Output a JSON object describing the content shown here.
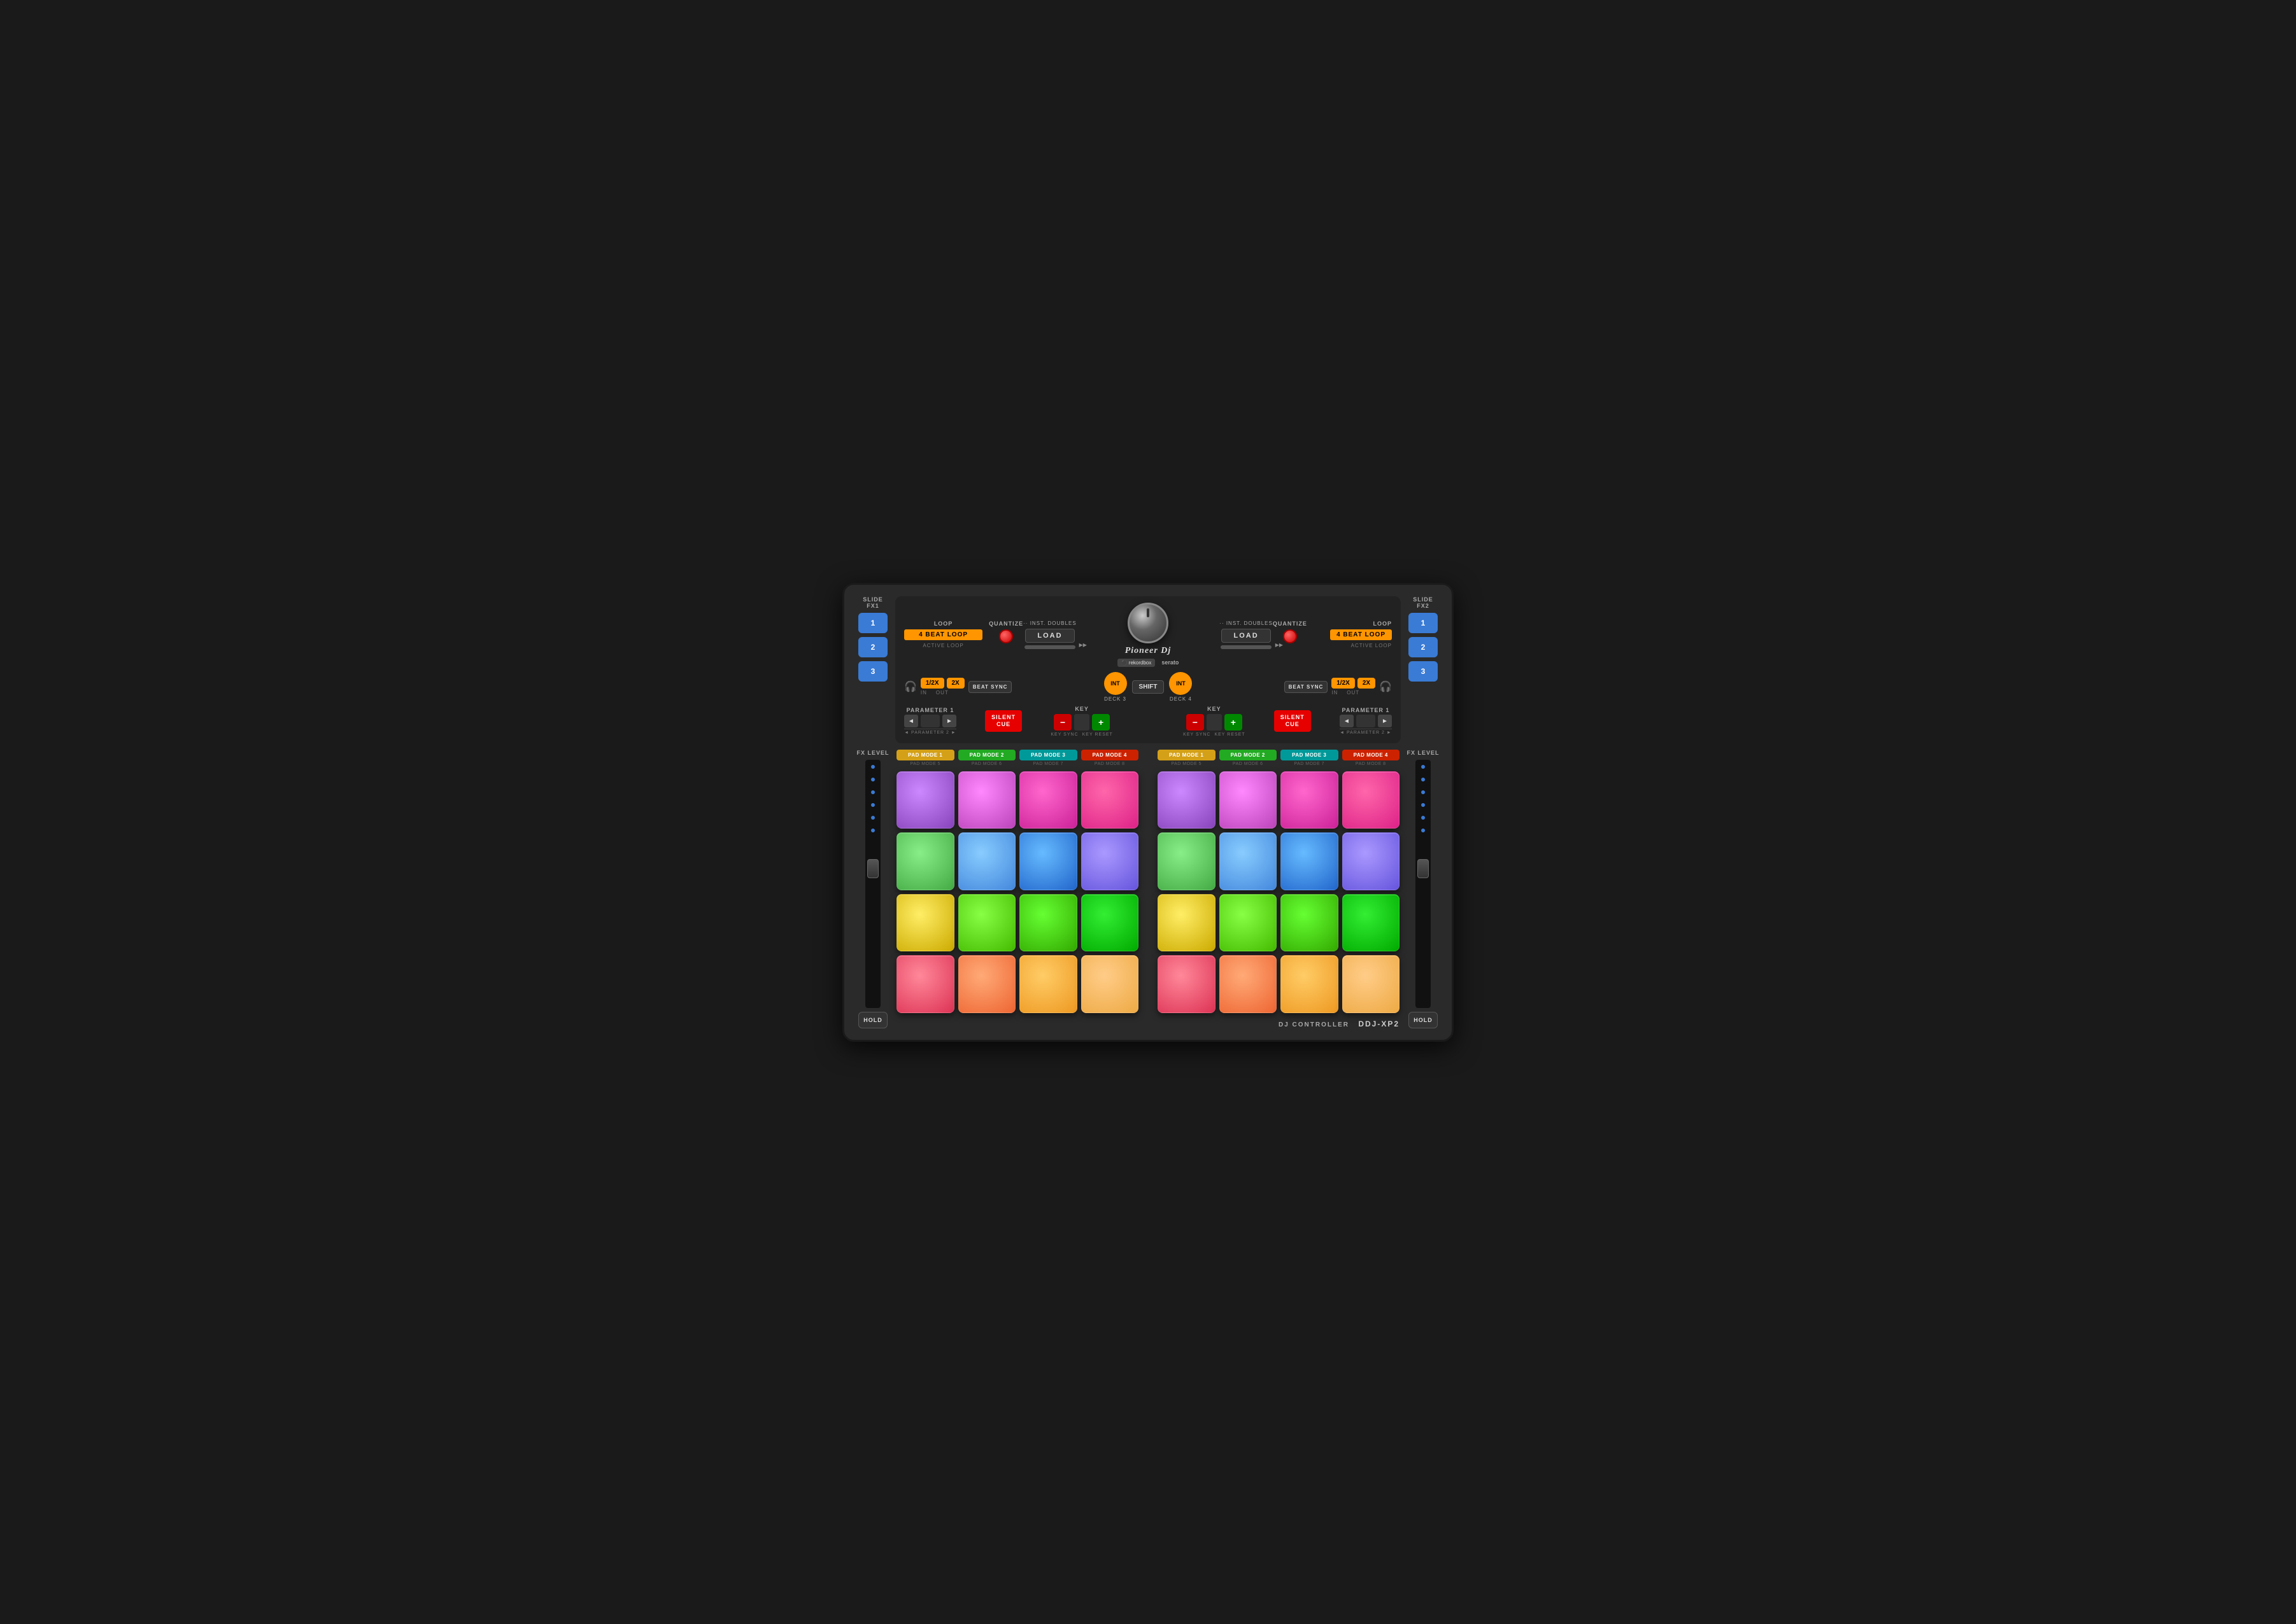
{
  "controller": {
    "model": "DDJ-XP2",
    "brand": "Pioneer Dj",
    "subtitle": "DJ CONTROLLER"
  },
  "slide_fx_left": {
    "label": "SLIDE FX1",
    "buttons": [
      "1",
      "2",
      "3"
    ]
  },
  "slide_fx_right": {
    "label": "SLIDE FX2",
    "buttons": [
      "1",
      "2",
      "3"
    ]
  },
  "deck_left": {
    "loop_label": "LOOP",
    "loop_value": "4 BEAT LOOP",
    "active_loop": "ACTIVE LOOP",
    "quantize_label": "QUANTIZE",
    "inst_doubles": "·· INST. DOUBLES",
    "load": "LOAD",
    "half_x": "1/2X",
    "two_x": "2X",
    "in_label": "IN",
    "out_label": "OUT",
    "beat_sync": "BEAT SYNC",
    "parameter1": "PARAMETER 1",
    "parameter2": "◄ PARAMETER 2 ►",
    "silent_cue": "SILENT CUE",
    "key_label": "KEY",
    "key_sync": "KEY SYNC",
    "key_reset": "KEY RESET",
    "deck_label": "DECK 3",
    "int_label": "INT"
  },
  "deck_right": {
    "loop_label": "LOOP",
    "loop_value": "4 BEAT LOOP",
    "active_loop": "ACTIVE LOOP",
    "quantize_label": "QUANTIZE",
    "inst_doubles": "·· INST. DOUBLES",
    "load": "LOAD",
    "half_x": "1/2X",
    "two_x": "2X",
    "in_label": "IN",
    "out_label": "OUT",
    "beat_sync": "BEAT SYNC",
    "parameter1": "PARAMETER 1",
    "parameter2": "◄ PARAMETER 2 ►",
    "silent_cue": "SILENT CUE",
    "key_label": "KEY",
    "key_sync": "KEY SYNC",
    "key_reset": "KEY RESET",
    "deck_label": "DECK 4",
    "int_label": "INT"
  },
  "center": {
    "shift": "SHIFT",
    "rekordbox": "rekordbox",
    "serato": "serato"
  },
  "fx_level_left": {
    "label": "FX LEVEL",
    "hold": "HOLD"
  },
  "fx_level_right": {
    "label": "FX LEVEL",
    "hold": "HOLD"
  },
  "pad_modes_left": [
    {
      "main": "PAD MODE 1",
      "sub": "PAD MODE 5",
      "color": "pm-yellow"
    },
    {
      "main": "PAD MODE 2",
      "sub": "PAD MODE 6",
      "color": "pm-green"
    },
    {
      "main": "PAD MODE 3",
      "sub": "PAD MODE 7",
      "color": "pm-teal"
    },
    {
      "main": "PAD MODE 4",
      "sub": "PAD MODE 8",
      "color": "pm-red"
    }
  ],
  "pad_modes_right": [
    {
      "main": "PAD MODE 1",
      "sub": "PAD MODE 5",
      "color": "pm-yellow"
    },
    {
      "main": "PAD MODE 2",
      "sub": "PAD MODE 6",
      "color": "pm-green"
    },
    {
      "main": "PAD MODE 3",
      "sub": "PAD MODE 7",
      "color": "pm-teal"
    },
    {
      "main": "PAD MODE 4",
      "sub": "PAD MODE 8",
      "color": "pm-red"
    }
  ],
  "pads_left": {
    "row1": [
      "pad-r1-1",
      "pad-r1-2",
      "pad-r1-3",
      "pad-r1-4"
    ],
    "row2": [
      "pad-r2-1",
      "pad-r2-2",
      "pad-r2-3",
      "pad-r2-4"
    ],
    "row3": [
      "pad-r3-1",
      "pad-r3-2",
      "pad-r3-3",
      "pad-r3-4"
    ],
    "row4": [
      "pad-r4-1",
      "pad-r4-2",
      "pad-r4-3",
      "pad-r4-4"
    ]
  },
  "pads_right": {
    "row1": [
      "pad-r1-1",
      "pad-r1-2",
      "pad-r1-3",
      "pad-r1-4"
    ],
    "row2": [
      "pad-r2-1",
      "pad-r2-2",
      "pad-r2-3",
      "pad-r2-4"
    ],
    "row3": [
      "pad-r3-1",
      "pad-r3-2",
      "pad-r3-3",
      "pad-r3-4"
    ],
    "row4": [
      "pad-r4-1",
      "pad-r4-2",
      "pad-r4-3",
      "pad-r4-4"
    ]
  }
}
